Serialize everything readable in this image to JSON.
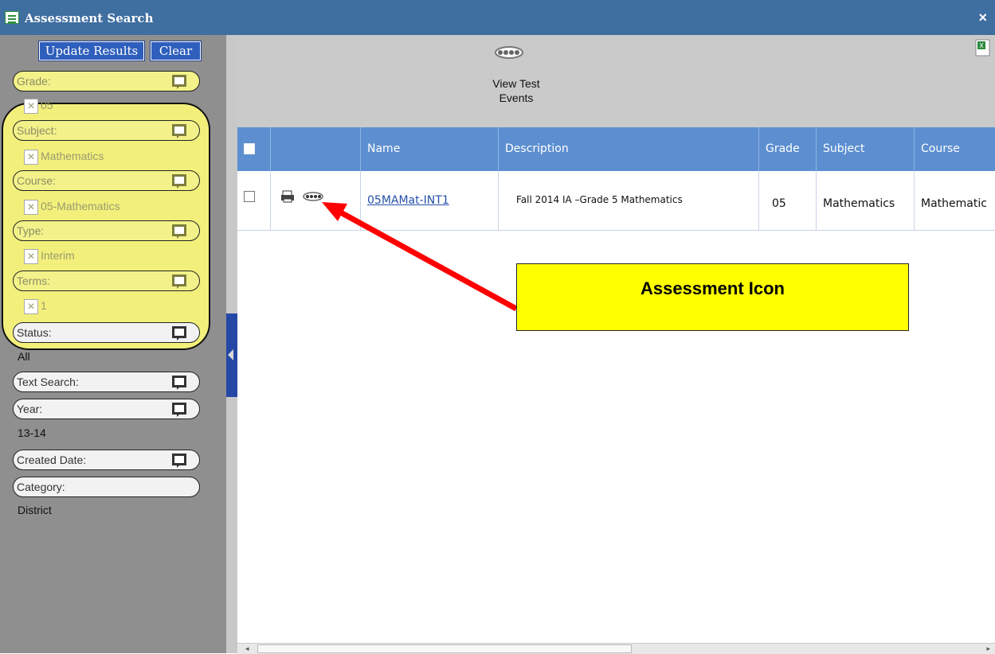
{
  "window": {
    "title": "Assessment Search",
    "close_label": "×"
  },
  "sidebar": {
    "update_button": "Update Results",
    "clear_button": "Clear",
    "filters": [
      {
        "label": "Grade:",
        "value": "05",
        "highlighted": true
      },
      {
        "label": "Subject:",
        "value": "Mathematics",
        "highlighted": true
      },
      {
        "label": "Course:",
        "value": "05-Mathematics",
        "highlighted": true
      },
      {
        "label": "Type:",
        "value": "Interim",
        "highlighted": true
      },
      {
        "label": "Terms:",
        "value": "1",
        "highlighted": true
      },
      {
        "label": "Status:",
        "value": "All",
        "highlighted": false
      },
      {
        "label": "Text Search:",
        "value": "",
        "highlighted": false
      },
      {
        "label": "Year:",
        "value": "13-14",
        "highlighted": false
      },
      {
        "label": "Created Date:",
        "value": "",
        "highlighted": false
      },
      {
        "label": "Category:",
        "value": "District",
        "highlighted": false
      }
    ]
  },
  "toolbar": {
    "view_test_events": "View Test\nEvents"
  },
  "grid": {
    "columns": [
      "Name",
      "Description",
      "Grade",
      "Subject",
      "Course"
    ],
    "rows": [
      {
        "name": "05MAMat-INT1",
        "description": "Fall 2014 IA –Grade 5 Mathematics",
        "grade": "05",
        "subject": "Mathematics",
        "course": "Mathematic"
      }
    ]
  },
  "annotation": {
    "callout_text": "Assessment Icon"
  },
  "colors": {
    "titlebar": "#3f6ea0",
    "header": "#5d8fd0",
    "highlight": "#f2f07b",
    "callout": "#ffff00",
    "arrow": "#ff0000"
  }
}
